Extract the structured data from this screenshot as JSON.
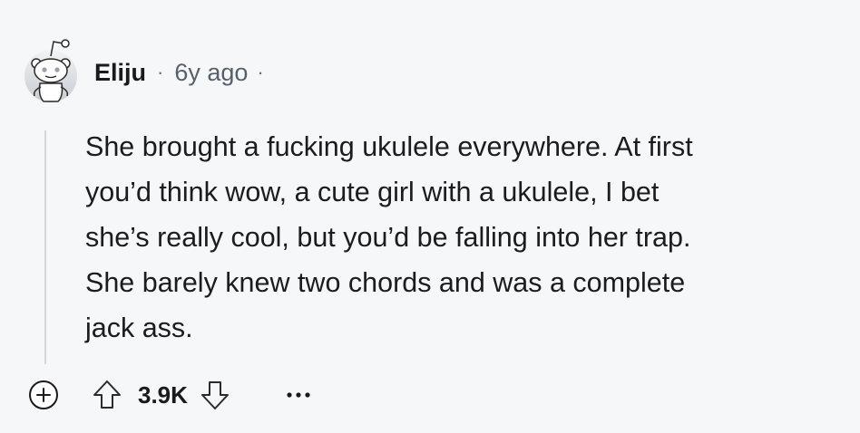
{
  "comment": {
    "author": "Eliju",
    "separator": "·",
    "timestamp": "6y ago",
    "body": "She brought a fucking ukulele everywhere. At first\nyou’d think wow, a cute girl with a ukulele, I bet\nshe’s really cool, but you’d be falling into her trap.\nShe barely knew two chords and was a complete\njack ass."
  },
  "actions": {
    "score": "3.9K",
    "more_label": "..."
  },
  "icons": {
    "avatar": "reddit-snoo-avatar-icon",
    "expand": "plus-circle-icon",
    "upvote": "arrow-up-outline-icon",
    "downvote": "arrow-down-outline-icon",
    "more": "ellipsis-icon"
  },
  "colors": {
    "background": "#f6f7f9",
    "text": "#1a1a1b",
    "meta": "#576069",
    "thread_line": "#d3d6da"
  }
}
